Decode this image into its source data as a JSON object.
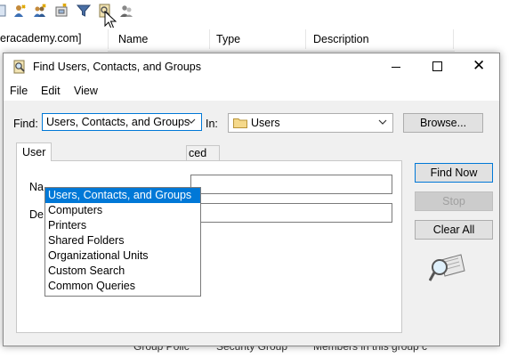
{
  "console": {
    "tree_item": "eracademy.com]",
    "columns": [
      "Name",
      "Type",
      "Description"
    ],
    "bottom_row": [
      "Group Polic",
      "Security Group",
      "Members in this group c"
    ]
  },
  "toolbar_icons": [
    "add-user-icon",
    "add-group-icon",
    "add-ou-icon",
    "filter-icon",
    "find-icon",
    "delegate-icon"
  ],
  "dialog": {
    "title": "Find Users, Contacts, and Groups",
    "menu": [
      "File",
      "Edit",
      "View"
    ],
    "find_label": "Find:",
    "find_value": "Users, Contacts, and Groups",
    "in_label": "In:",
    "in_value": "Users",
    "browse_label": "Browse...",
    "tabs": [
      "Users",
      "Advanced"
    ],
    "tab_visible": [
      "User",
      "ced"
    ],
    "fields": [
      {
        "label_visible": "Na"
      },
      {
        "label_visible": "De"
      }
    ],
    "buttons": {
      "find_now": "Find Now",
      "stop": "Stop",
      "clear_all": "Clear All"
    },
    "find_options": [
      "Users, Contacts, and Groups",
      "Computers",
      "Printers",
      "Shared Folders",
      "Organizational Units",
      "Custom Search",
      "Common Queries"
    ],
    "selected_option_index": 0
  },
  "colors": {
    "accent": "#0078d7",
    "dialog_bg": "#f0f0f0",
    "button_bg": "#e1e1e1"
  }
}
